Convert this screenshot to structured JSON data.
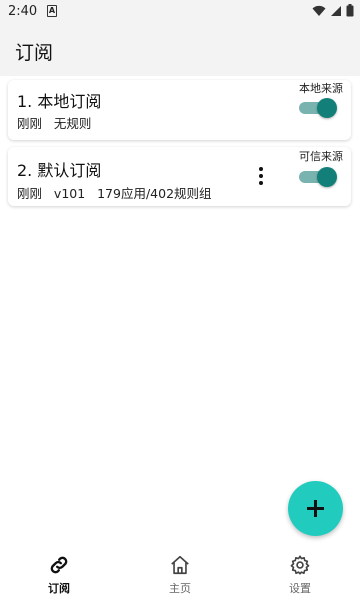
{
  "status_bar": {
    "time": "2:40",
    "notif_letter": "A"
  },
  "app_bar": {
    "title": "订阅"
  },
  "subscriptions": [
    {
      "title": "1. 本地订阅",
      "meta": "刚刚   无规则",
      "source": "本地来源",
      "enabled": true,
      "has_menu": false
    },
    {
      "title": "2. 默认订阅",
      "meta": "刚刚   v101   179应用/402规则组",
      "source": "可信来源",
      "enabled": true,
      "has_menu": true
    }
  ],
  "nav": {
    "subscriptions": "订阅",
    "home": "主页",
    "settings": "设置"
  },
  "colors": {
    "accent": "#128079",
    "track": "#79b3af",
    "fab": "#21ccbf"
  }
}
